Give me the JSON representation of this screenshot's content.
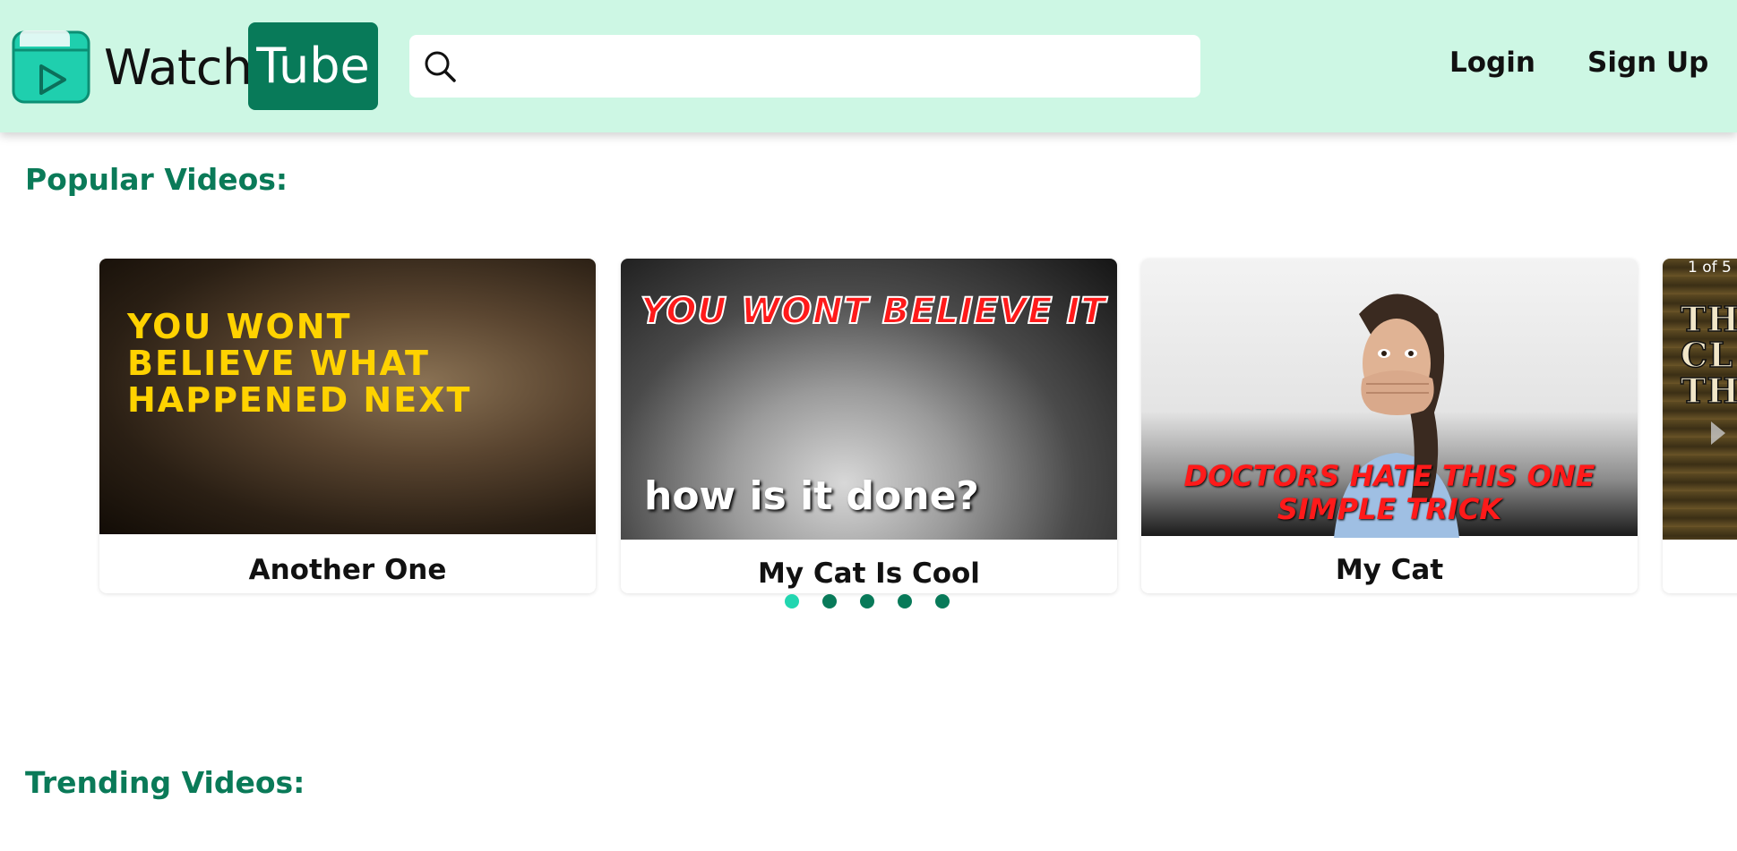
{
  "header": {
    "logo_text": "Watch",
    "logo_badge": "Tube",
    "search": {
      "placeholder": "",
      "value": ""
    },
    "nav": {
      "login": "Login",
      "signup": "Sign Up"
    }
  },
  "sections": {
    "popular": "Popular Videos:",
    "trending": "Trending Videos:"
  },
  "carousel": {
    "counter": "1 of 5",
    "cards": [
      {
        "title": "Another One",
        "thumb_text": "YOU WONT BELIEVE WHAT HAPPENED NEXT"
      },
      {
        "title": "My Cat Is Cool",
        "thumb_text_top": "YOU WONT BELIEVE IT",
        "thumb_text_bottom": "how is it done?"
      },
      {
        "title": "My Cat",
        "thumb_text": "DOCTORS HATE THIS ONE SIMPLE TRICK"
      },
      {
        "title": "",
        "thumb_text": "TH CL TH"
      }
    ],
    "dots_total": 5,
    "active_dot": 1
  },
  "colors": {
    "header_bg": "#cdf7e4",
    "brand_green": "#087a59",
    "dot_active": "#22d6b0"
  },
  "icons": {
    "logo": "folder-play-icon",
    "search": "search-icon",
    "next": "chevron-right-icon"
  }
}
